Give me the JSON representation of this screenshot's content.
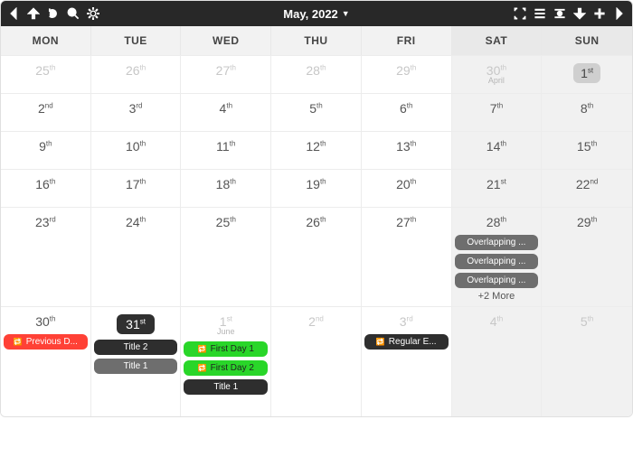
{
  "toolbar": {
    "title": "May, 2022",
    "left_icons": [
      "prev",
      "up",
      "repeat",
      "search",
      "gear"
    ],
    "right_icons": [
      "fullscreen",
      "menu",
      "target",
      "down",
      "plus",
      "next"
    ]
  },
  "weekdays": [
    "MON",
    "TUE",
    "WED",
    "THU",
    "FRI",
    "SAT",
    "SUN"
  ],
  "rows": [
    {
      "h": "short",
      "cells": [
        {
          "day": "25",
          "ord": "th",
          "muted": true,
          "wk": false
        },
        {
          "day": "26",
          "ord": "th",
          "muted": true,
          "wk": false
        },
        {
          "day": "27",
          "ord": "th",
          "muted": true,
          "wk": false
        },
        {
          "day": "28",
          "ord": "th",
          "muted": true,
          "wk": false
        },
        {
          "day": "29",
          "ord": "th",
          "muted": true,
          "wk": false
        },
        {
          "day": "30",
          "ord": "th",
          "muted": true,
          "wk": true,
          "monthlabel": "April"
        },
        {
          "day": "1",
          "ord": "st",
          "muted": false,
          "wk": true,
          "todaybox": true
        }
      ]
    },
    {
      "h": "short",
      "cells": [
        {
          "day": "2",
          "ord": "nd"
        },
        {
          "day": "3",
          "ord": "rd"
        },
        {
          "day": "4",
          "ord": "th"
        },
        {
          "day": "5",
          "ord": "th"
        },
        {
          "day": "6",
          "ord": "th"
        },
        {
          "day": "7",
          "ord": "th",
          "wk": true
        },
        {
          "day": "8",
          "ord": "th",
          "wk": true
        }
      ]
    },
    {
      "h": "short",
      "cells": [
        {
          "day": "9",
          "ord": "th"
        },
        {
          "day": "10",
          "ord": "th"
        },
        {
          "day": "11",
          "ord": "th"
        },
        {
          "day": "12",
          "ord": "th"
        },
        {
          "day": "13",
          "ord": "th"
        },
        {
          "day": "14",
          "ord": "th",
          "wk": true
        },
        {
          "day": "15",
          "ord": "th",
          "wk": true
        }
      ]
    },
    {
      "h": "short",
      "cells": [
        {
          "day": "16",
          "ord": "th"
        },
        {
          "day": "17",
          "ord": "th"
        },
        {
          "day": "18",
          "ord": "th"
        },
        {
          "day": "19",
          "ord": "th"
        },
        {
          "day": "20",
          "ord": "th"
        },
        {
          "day": "21",
          "ord": "st",
          "wk": true
        },
        {
          "day": "22",
          "ord": "nd",
          "wk": true
        }
      ]
    },
    {
      "h": "tall",
      "cells": [
        {
          "day": "23",
          "ord": "rd"
        },
        {
          "day": "24",
          "ord": "th"
        },
        {
          "day": "25",
          "ord": "th"
        },
        {
          "day": "26",
          "ord": "th"
        },
        {
          "day": "27",
          "ord": "th"
        },
        {
          "day": "28",
          "ord": "th",
          "wk": true,
          "events": [
            {
              "label": "Overlapping ...",
              "cls": "gray"
            },
            {
              "label": "Overlapping ...",
              "cls": "gray"
            },
            {
              "label": "Overlapping ...",
              "cls": "gray"
            }
          ],
          "more": "+2 More"
        },
        {
          "day": "29",
          "ord": "th",
          "wk": true
        }
      ]
    },
    {
      "h": "last",
      "cells": [
        {
          "day": "30",
          "ord": "th",
          "events": [
            {
              "label": "Previous D...",
              "cls": "red",
              "repeat": true
            }
          ]
        },
        {
          "day": "31",
          "ord": "st",
          "today": true,
          "events": [
            {
              "label": "Title 2",
              "cls": "dark"
            },
            {
              "label": "Title 1",
              "cls": "gray"
            }
          ]
        },
        {
          "day": "1",
          "ord": "st",
          "muted": true,
          "monthlabel": "June",
          "events": [
            {
              "label": "First Day 1",
              "cls": "green",
              "repeat": true
            },
            {
              "label": "First Day 2",
              "cls": "green",
              "repeat": true
            },
            {
              "label": "Title 1",
              "cls": "dark"
            }
          ]
        },
        {
          "day": "2",
          "ord": "nd",
          "muted": true
        },
        {
          "day": "3",
          "ord": "rd",
          "muted": true,
          "events": [
            {
              "label": "Regular E...",
              "cls": "dark",
              "repeat": true
            }
          ]
        },
        {
          "day": "4",
          "ord": "th",
          "muted": true,
          "wk": true
        },
        {
          "day": "5",
          "ord": "th",
          "muted": true,
          "wk": true
        }
      ]
    }
  ]
}
